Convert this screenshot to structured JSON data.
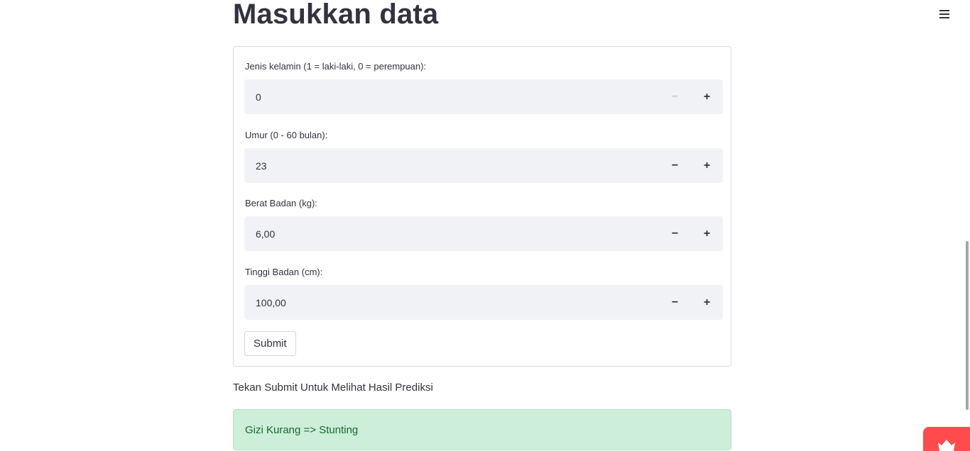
{
  "header": {
    "title": "Masukkan data",
    "menu_icon": "hamburger-menu-icon"
  },
  "form": {
    "fields": [
      {
        "label": "Jenis kelamin (1 = laki-laki, 0 = perempuan):",
        "value": "0",
        "minus_disabled": true
      },
      {
        "label": "Umur (0 - 60 bulan):",
        "value": "23",
        "minus_disabled": false
      },
      {
        "label": "Berat Badan (kg):",
        "value": "6,00",
        "minus_disabled": false
      },
      {
        "label": "Tinggi Badan (cm):",
        "value": "100,00",
        "minus_disabled": false
      }
    ],
    "minus_symbol": "−",
    "plus_symbol": "+",
    "submit_label": "Submit"
  },
  "hint": "Tekan Submit Untuk Melihat Hasil Prediksi",
  "result": {
    "text": "Gizi Kurang => Stunting",
    "status": "success"
  },
  "badge": {
    "icon": "crown-icon",
    "color": "#ff4b4b"
  },
  "colors": {
    "accent": "#ff4b4b",
    "success_bg": "#cdeed8",
    "success_text": "#156a2f",
    "input_bg": "#f0f2f6"
  }
}
